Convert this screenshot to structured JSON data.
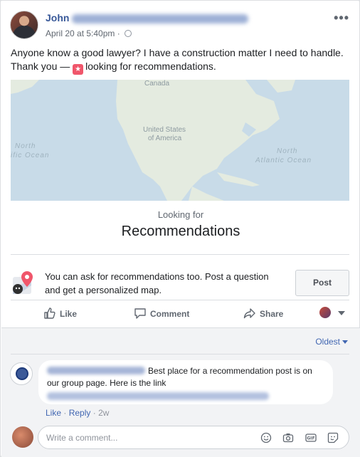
{
  "post": {
    "author": "John",
    "date": "April 20 at 5:40pm",
    "dot": "·",
    "more": "•••",
    "text_line1": "Anyone know a good lawyer? I have a construction matter I need to handle.",
    "text_line2a": "Thank you —",
    "badge_glyph": "★",
    "text_line2b": "looking for recommendations."
  },
  "map": {
    "label_us": "United States",
    "label_us2": "of America",
    "label_north_left": "North",
    "label_ocean_left": "ific Ocean",
    "label_north_right": "North",
    "label_ocean_right": "Atlantic Ocean",
    "label_canada": "Canada"
  },
  "recommendations": {
    "looking_for": "Looking for",
    "title": "Recommendations"
  },
  "cta": {
    "line1": "You can ask for recommendations too. Post a question",
    "line2": "and get a personalized map.",
    "button": "Post"
  },
  "actions": {
    "like": "Like",
    "comment": "Comment",
    "share": "Share"
  },
  "comments": {
    "sort": "Oldest",
    "items": [
      {
        "text_part1": "Best place for a recommendation post is on",
        "text_part2": "our group page. Here is the link",
        "like": "Like",
        "sep1": "·",
        "reply": "Reply",
        "sep2": "·",
        "age": "2w"
      }
    ]
  },
  "write": {
    "placeholder": "Write a comment..."
  },
  "colors": {
    "link_blue": "#385898",
    "accent_blue": "#4267b2",
    "map_water": "#c8dbe8",
    "map_land": "#e4ebe0"
  }
}
